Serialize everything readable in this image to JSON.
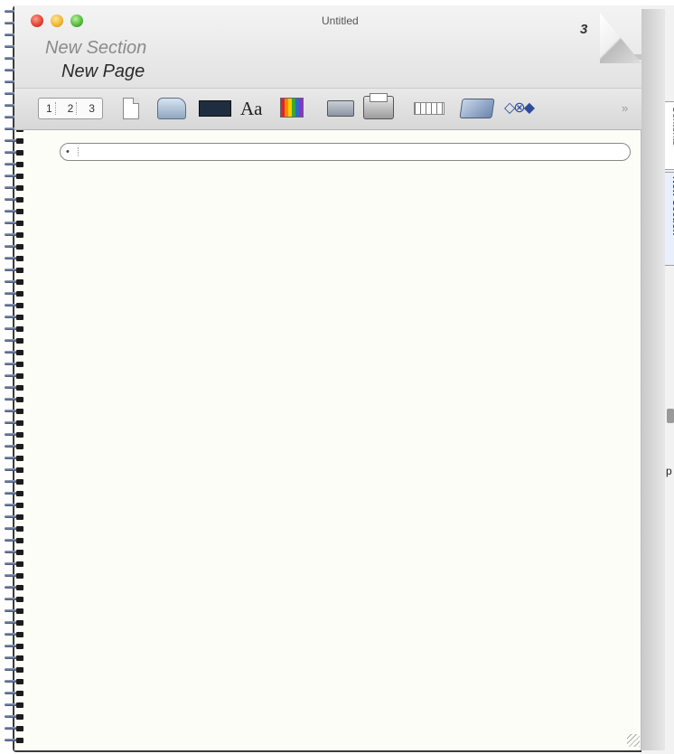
{
  "window": {
    "title": "Untitled",
    "section_name": "New Section",
    "page_name": "New Page",
    "page_number": "3"
  },
  "toolbar": {
    "numbering": [
      "1",
      "2",
      "3"
    ],
    "font_label": "Aa",
    "nav_glyph": "◇⊗◆",
    "more_glyph": "»"
  },
  "outline": {
    "handle_glyph": "•",
    "text": ""
  },
  "side_tabs": {
    "contents_label": "Contents",
    "section_label": "New Section",
    "edge_char": "p"
  },
  "colors": {
    "paper": "#fdfdf8",
    "spiral_wire": "#3d4c70",
    "close": "#e0402f",
    "minimize": "#f0b32c",
    "zoom": "#4fb83a"
  }
}
